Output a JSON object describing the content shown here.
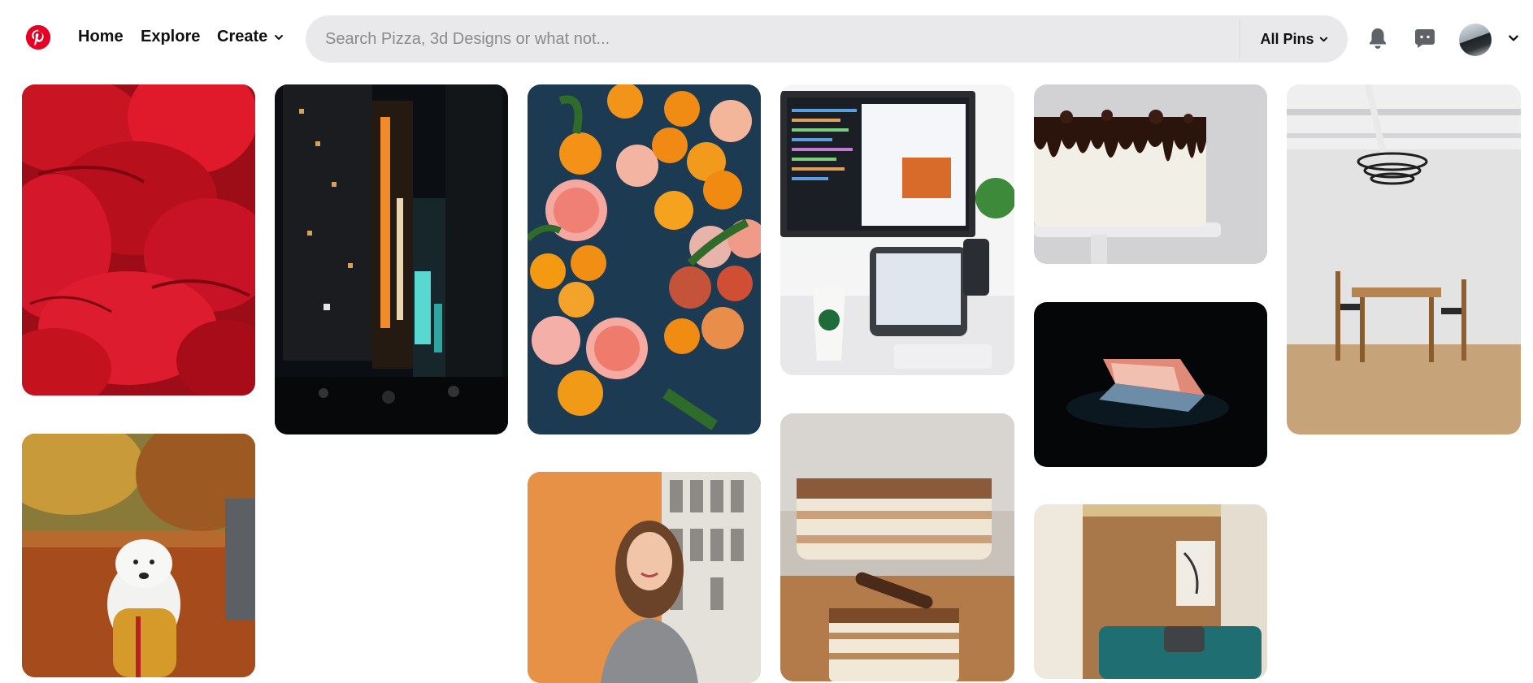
{
  "header": {
    "logo": "pinterest-logo",
    "nav": {
      "home": "Home",
      "explore": "Explore",
      "create": "Create"
    },
    "search": {
      "placeholder": "Search Pizza, 3d Designs or what not...",
      "value": "",
      "filter_label": "All Pins"
    },
    "icons": [
      "bell-icon",
      "chat-icon",
      "chevron-down-icon"
    ],
    "brand_color": "#e60023",
    "search_bg": "#e9e9eb"
  },
  "pins": [
    {
      "column": 1,
      "subject": "red rose petals"
    },
    {
      "column": 1,
      "subject": "white samoyed dog in yellow jacket on autumn street"
    },
    {
      "column": 2,
      "subject": "city street at night with neon signs"
    },
    {
      "column": 3,
      "subject": "oranges and grapefruit halves on dark blue background"
    },
    {
      "column": 3,
      "subject": "smiling woman by orange wall"
    },
    {
      "column": 4,
      "subject": "desk with monitor, tablet, phone and coffee cup"
    },
    {
      "column": 4,
      "subject": "layered tiramisu cake slices"
    },
    {
      "column": 5,
      "subject": "white cake with chocolate drip"
    },
    {
      "column": 5,
      "subject": "laptop glowing in the dark"
    },
    {
      "column": 5,
      "subject": "interior with teal sofa and wood wall"
    },
    {
      "column": 6,
      "subject": "dining table with chairs and pendant lamp"
    }
  ]
}
